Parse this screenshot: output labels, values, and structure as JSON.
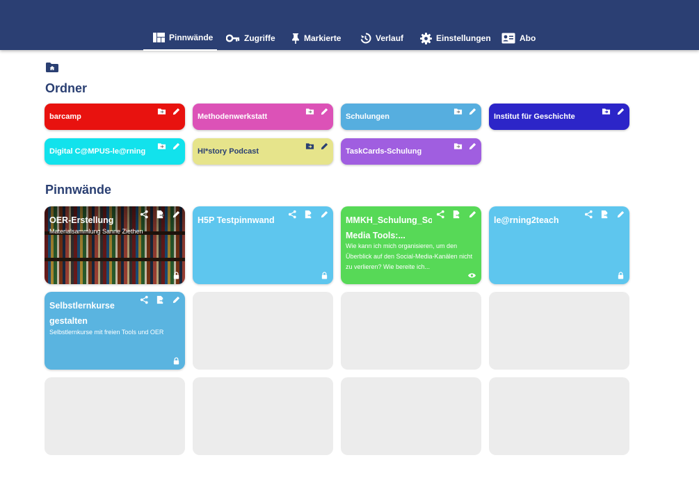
{
  "nav": {
    "items": [
      {
        "label": "Pinnwände",
        "icon": "dashboard-icon",
        "active": true
      },
      {
        "label": "Zugriffe",
        "icon": "key-icon",
        "active": false
      },
      {
        "label": "Markierte",
        "icon": "pin-icon",
        "active": false
      },
      {
        "label": "Verlauf",
        "icon": "history-icon",
        "active": false
      },
      {
        "label": "Einstellungen",
        "icon": "gear-icon",
        "active": false
      },
      {
        "label": "Abo",
        "icon": "id-card-icon",
        "active": false
      }
    ]
  },
  "colors": {
    "header": "#2b3f73",
    "title_text": "#2a3f72",
    "placeholder": "#ececec"
  },
  "folders": {
    "title": "Ordner",
    "items": [
      {
        "name": "barcamp",
        "color": "#e8120f",
        "text_color": "#ffffff"
      },
      {
        "name": "Methodenwerkstatt",
        "color": "#dc52b7",
        "text_color": "#ffffff"
      },
      {
        "name": "Schulungen",
        "color": "#56aedf",
        "text_color": "#ffffff"
      },
      {
        "name": "Institut für Geschichte",
        "color": "#2c25c8",
        "text_color": "#ffffff"
      },
      {
        "name": "Digital C@MPUS-le@rning",
        "color": "#12e2ec",
        "text_color": "#ffffff"
      },
      {
        "name": "HI*story Podcast",
        "color": "#e6e48b",
        "text_color": "#2a3f72"
      },
      {
        "name": "TaskCards-Schulung",
        "color": "#a05ee0",
        "text_color": "#ffffff"
      }
    ]
  },
  "boards": {
    "title": "Pinnwände",
    "items": [
      {
        "title": "OER-Erstellung",
        "description": "Materialsammlung Sanne Ziethen",
        "color": "#3a2a22",
        "status_icon": "lock-icon",
        "has_image": true
      },
      {
        "title": "H5P Testpinnwand",
        "description": "",
        "color": "#5ec6ee",
        "status_icon": "lock-icon",
        "has_image": false
      },
      {
        "title": "MMKH_Schulung_Social Media Tools:...",
        "description": "Wie kann ich mich organisieren, um den Überblick auf den Social-Media-Kanälen nicht zu verlieren? Wie bereite ich...",
        "color": "#57d957",
        "status_icon": "eye-icon",
        "has_image": false
      },
      {
        "title": "le@rning2teach",
        "description": "",
        "color": "#5ec6ee",
        "status_icon": "lock-icon",
        "has_image": false
      },
      {
        "title": "Selbstlernkurse gestalten",
        "description": "Selbstlernkurse mit freien Tools und OER",
        "color": "#5ab4e0",
        "status_icon": "lock-icon",
        "has_image": false
      }
    ]
  }
}
